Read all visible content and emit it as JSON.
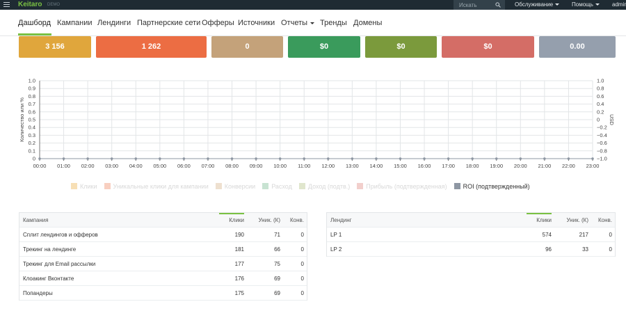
{
  "topbar": {
    "brand": "Keitaro",
    "brand_sub": "DEMO",
    "search_placeholder": "Искать",
    "service": "Обслуживание",
    "help": "Помощь",
    "user": "admin"
  },
  "nav": {
    "items": [
      {
        "label": "Дашборд"
      },
      {
        "label": "Кампании"
      },
      {
        "label": "Лендинги"
      },
      {
        "label": "Партнерские сети"
      },
      {
        "label": "Офферы"
      },
      {
        "label": "Источники"
      },
      {
        "label": "Отчеты"
      },
      {
        "label": "Тренды"
      },
      {
        "label": "Домены"
      }
    ]
  },
  "stats": [
    {
      "value": "3 156",
      "color": "#e0a63c"
    },
    {
      "value": "1 262",
      "color": "#ec6d43"
    },
    {
      "value": "0",
      "color": "#c4a27a"
    },
    {
      "value": "$0",
      "color": "#3a9b5c"
    },
    {
      "value": "$0",
      "color": "#7b9a3c"
    },
    {
      "value": "$0",
      "color": "#d46d66"
    },
    {
      "value": "0.00",
      "color": "#959fad"
    }
  ],
  "chart_data": {
    "type": "line",
    "x": [
      "00:00",
      "01:00",
      "02:00",
      "03:00",
      "04:00",
      "05:00",
      "06:00",
      "07:00",
      "08:00",
      "09:00",
      "10:00",
      "11:00",
      "12:00",
      "13:00",
      "14:00",
      "15:00",
      "16:00",
      "17:00",
      "18:00",
      "19:00",
      "20:00",
      "21:00",
      "22:00",
      "23:00"
    ],
    "ylabel": "Количество или %",
    "y2label": "USD",
    "ylim": [
      0,
      1.0
    ],
    "y_ticks": [
      "0",
      "0.1",
      "0.2",
      "0.3",
      "0.4",
      "0.5",
      "0.6",
      "0.7",
      "0.8",
      "0.9",
      "1.0"
    ],
    "y2lim": [
      -1.0,
      1.0
    ],
    "y2_ticks": [
      "−1.0",
      "−0.8",
      "−0.6",
      "−0.4",
      "−0.2",
      "0",
      "0.2",
      "0.4",
      "0.6",
      "0.8",
      "1.0"
    ],
    "grid": true,
    "legend_position": "bottom",
    "series": [
      {
        "name": "Клики",
        "color": "#f7dfb5",
        "values": [
          0,
          0,
          0,
          0,
          0,
          0,
          0,
          0,
          0,
          0,
          0,
          0,
          0,
          0,
          0,
          0,
          0,
          0,
          0,
          0,
          0,
          0,
          0,
          0
        ]
      },
      {
        "name": "Уникальные клики для кампании",
        "color": "#f8cfc0",
        "values": [
          0,
          0,
          0,
          0,
          0,
          0,
          0,
          0,
          0,
          0,
          0,
          0,
          0,
          0,
          0,
          0,
          0,
          0,
          0,
          0,
          0,
          0,
          0,
          0
        ]
      },
      {
        "name": "Конверсии",
        "color": "#eee0cf",
        "values": [
          0,
          0,
          0,
          0,
          0,
          0,
          0,
          0,
          0,
          0,
          0,
          0,
          0,
          0,
          0,
          0,
          0,
          0,
          0,
          0,
          0,
          0,
          0,
          0
        ]
      },
      {
        "name": "Расход",
        "color": "#c8e3d2",
        "values": [
          0,
          0,
          0,
          0,
          0,
          0,
          0,
          0,
          0,
          0,
          0,
          0,
          0,
          0,
          0,
          0,
          0,
          0,
          0,
          0,
          0,
          0,
          0,
          0
        ]
      },
      {
        "name": "Доход (подтв.)",
        "color": "#e0e6cd",
        "values": [
          0,
          0,
          0,
          0,
          0,
          0,
          0,
          0,
          0,
          0,
          0,
          0,
          0,
          0,
          0,
          0,
          0,
          0,
          0,
          0,
          0,
          0,
          0,
          0
        ]
      },
      {
        "name": "Прибыль (подтвержденная)",
        "color": "#f2cfcc",
        "values": [
          0,
          0,
          0,
          0,
          0,
          0,
          0,
          0,
          0,
          0,
          0,
          0,
          0,
          0,
          0,
          0,
          0,
          0,
          0,
          0,
          0,
          0,
          0,
          0
        ]
      },
      {
        "name": "ROI (подтвержденный)",
        "color": "#8e97a3",
        "values": [
          0,
          0,
          0,
          0,
          0,
          0,
          0,
          0,
          0,
          0,
          0,
          0,
          0,
          0,
          0,
          0,
          0,
          0,
          0,
          0,
          0,
          0,
          0,
          0
        ]
      }
    ]
  },
  "campaigns_table": {
    "headers": [
      "Кампания",
      "Клики",
      "Уник. (К)",
      "Конв."
    ],
    "rows": [
      [
        "Сплит лендингов и офферов",
        "190",
        "71",
        "0"
      ],
      [
        "Трекинг на лендинге",
        "181",
        "66",
        "0"
      ],
      [
        "Трекинг для Email рассылки",
        "177",
        "75",
        "0"
      ],
      [
        "Клоакинг Вконтакте",
        "176",
        "69",
        "0"
      ],
      [
        "Попандеры",
        "175",
        "69",
        "0"
      ]
    ]
  },
  "landings_table": {
    "headers": [
      "Лендинг",
      "Клики",
      "Уник. (К)",
      "Конв."
    ],
    "rows": [
      [
        "LP 1",
        "574",
        "217",
        "0"
      ],
      [
        "LP 2",
        "96",
        "33",
        "0"
      ]
    ]
  }
}
